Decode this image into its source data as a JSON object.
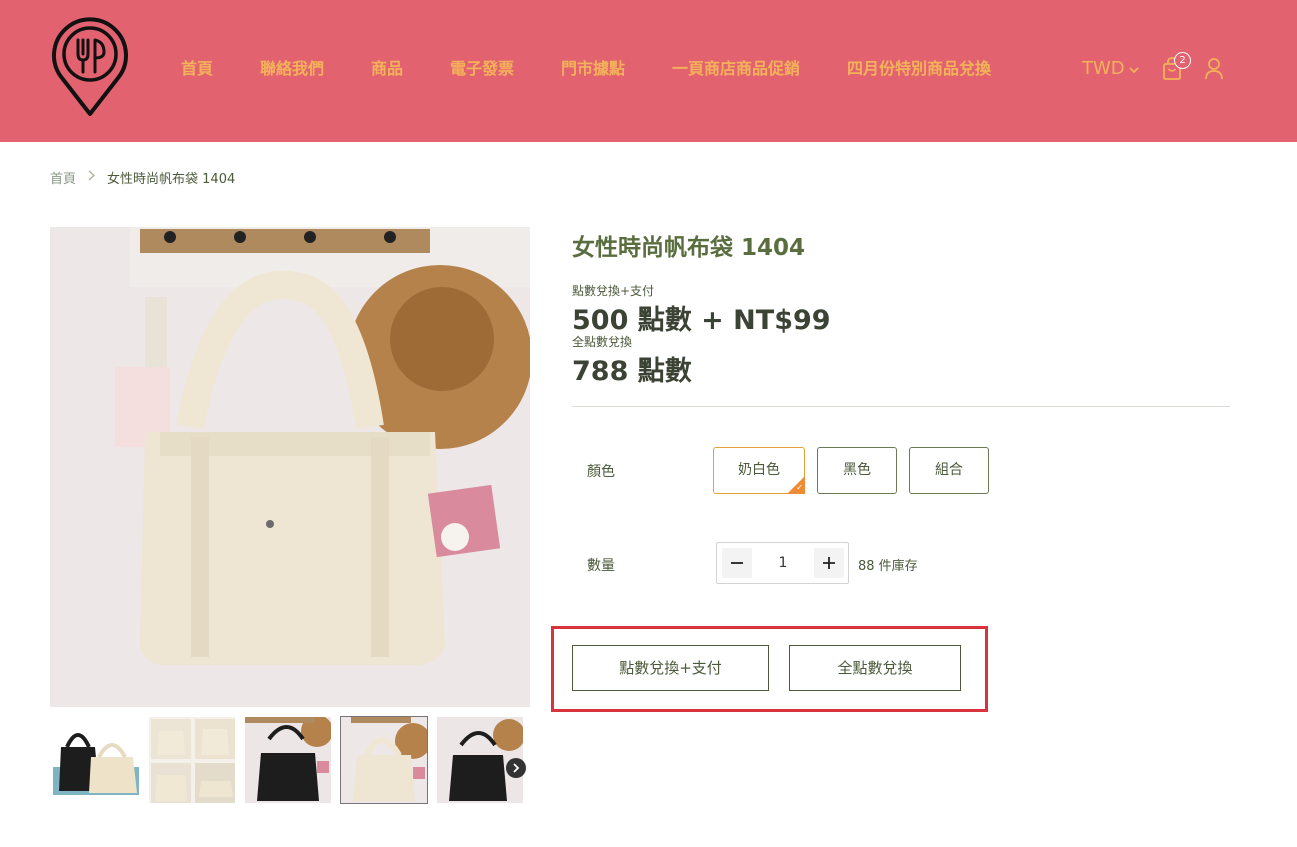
{
  "header": {
    "nav": [
      {
        "label": "首頁"
      },
      {
        "label": "聯絡我們"
      },
      {
        "label": "商品"
      },
      {
        "label": "電子發票"
      },
      {
        "label": "門市據點"
      },
      {
        "label": "一頁商店商品促銷"
      },
      {
        "label": "四月份特別商品兌換"
      }
    ],
    "currency": "TWD",
    "cart_count": "2",
    "colors": {
      "bar": "#e26270",
      "nav_text": "#f3b25a"
    },
    "icons": {
      "logo": "location-pin-fork-logo",
      "cart": "shopping-bag-icon",
      "user": "user-icon",
      "caret": "chevron-down-icon"
    }
  },
  "breadcrumb": {
    "home": "首頁",
    "current": "女性時尚帆布袋 1404"
  },
  "product": {
    "title": "女性時尚帆布袋 1404",
    "price_options": [
      {
        "label": "點數兌換+支付",
        "price": "500 點數 + NT$99"
      },
      {
        "label": "全點數兌換",
        "price": "788 點數"
      }
    ],
    "color_label": "顏色",
    "colors": [
      {
        "label": "奶白色",
        "selected": true
      },
      {
        "label": "黑色",
        "selected": false
      },
      {
        "label": "組合",
        "selected": false
      }
    ],
    "quantity_label": "數量",
    "quantity": "1",
    "stock": "88 件庫存",
    "actions": {
      "points_plus_pay": "點數兌換+支付",
      "full_points": "全點數兌換"
    }
  }
}
